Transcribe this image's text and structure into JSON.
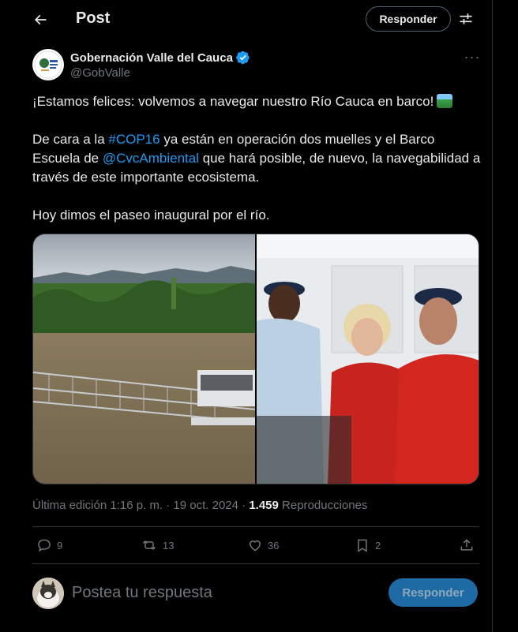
{
  "header": {
    "title": "Post",
    "reply_label": "Responder"
  },
  "author": {
    "name": "Gobernación Valle del Cauca",
    "handle": "@GobValle",
    "verified_color": "#1d9bf0"
  },
  "tweet": {
    "line1": "¡Estamos felices: volvemos a navegar nuestro Río Cauca en barco!",
    "p2_a": "De cara a la ",
    "hashtag": "#COP16",
    "p2_b": " ya están en operación dos muelles y el Barco Escuela de ",
    "mention": "@CvcAmbiental",
    "p2_c": " que hará posible, de nuevo, la navegabilidad a través de este importante ecosistema.",
    "p3": "Hoy dimos el paseo inaugural por el río."
  },
  "meta": {
    "edited_label": "Última edición 1:16 p. m. · 19 oct. 2024 · ",
    "views_count": "1.459",
    "views_label": " Reproducciones"
  },
  "actions": {
    "replies": "9",
    "reposts": "13",
    "likes": "36",
    "bookmarks": "2"
  },
  "composer": {
    "placeholder": "Postea tu respuesta",
    "submit_label": "Responder"
  },
  "colors": {
    "accent": "#1d9bf0",
    "muted": "#71767b",
    "border": "#2f3336"
  }
}
